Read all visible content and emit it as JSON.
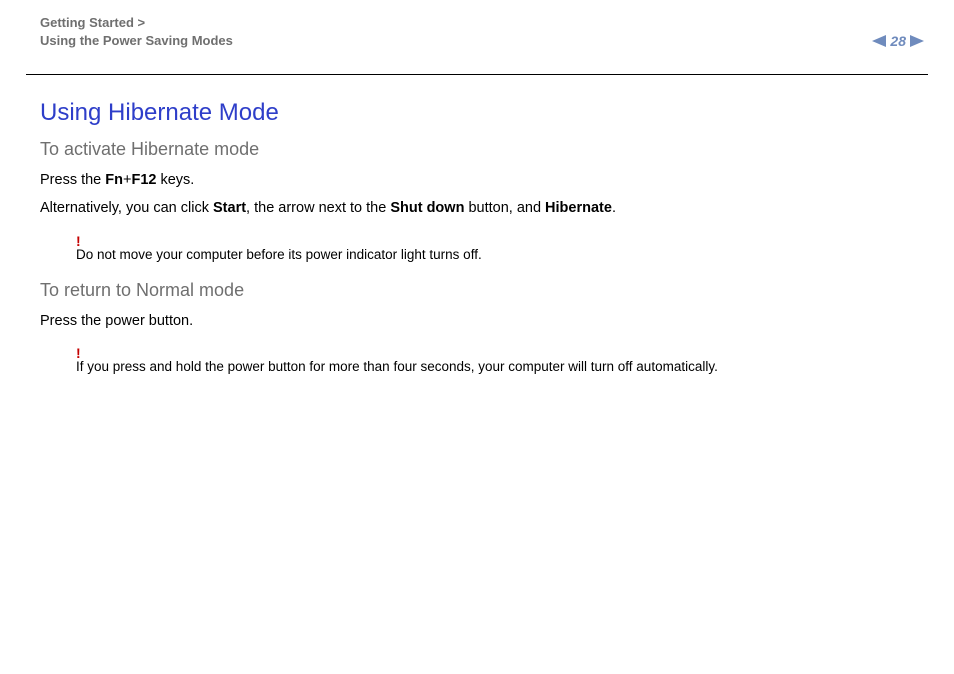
{
  "header": {
    "breadcrumb_line1": "Getting Started >",
    "breadcrumb_line2": "Using the Power Saving Modes",
    "page_number": "28"
  },
  "content": {
    "title": "Using Hibernate Mode",
    "section1": {
      "heading": "To activate Hibernate mode",
      "p1": {
        "pre": "Press the ",
        "b1": "Fn",
        "mid1": "+",
        "b2": "F12",
        "post": " keys."
      },
      "p2": {
        "pre": "Alternatively, you can click ",
        "b1": "Start",
        "mid1": ", the arrow next to the ",
        "b2": "Shut down",
        "mid2": " button, and ",
        "b3": "Hibernate",
        "post": "."
      },
      "note": {
        "bang": "!",
        "text": "Do not move your computer before its power indicator light turns off."
      }
    },
    "section2": {
      "heading": "To return to Normal mode",
      "p1": "Press the power button.",
      "note": {
        "bang": "!",
        "text": "If you press and hold the power button for more than four seconds, your computer will turn off automatically."
      }
    }
  }
}
